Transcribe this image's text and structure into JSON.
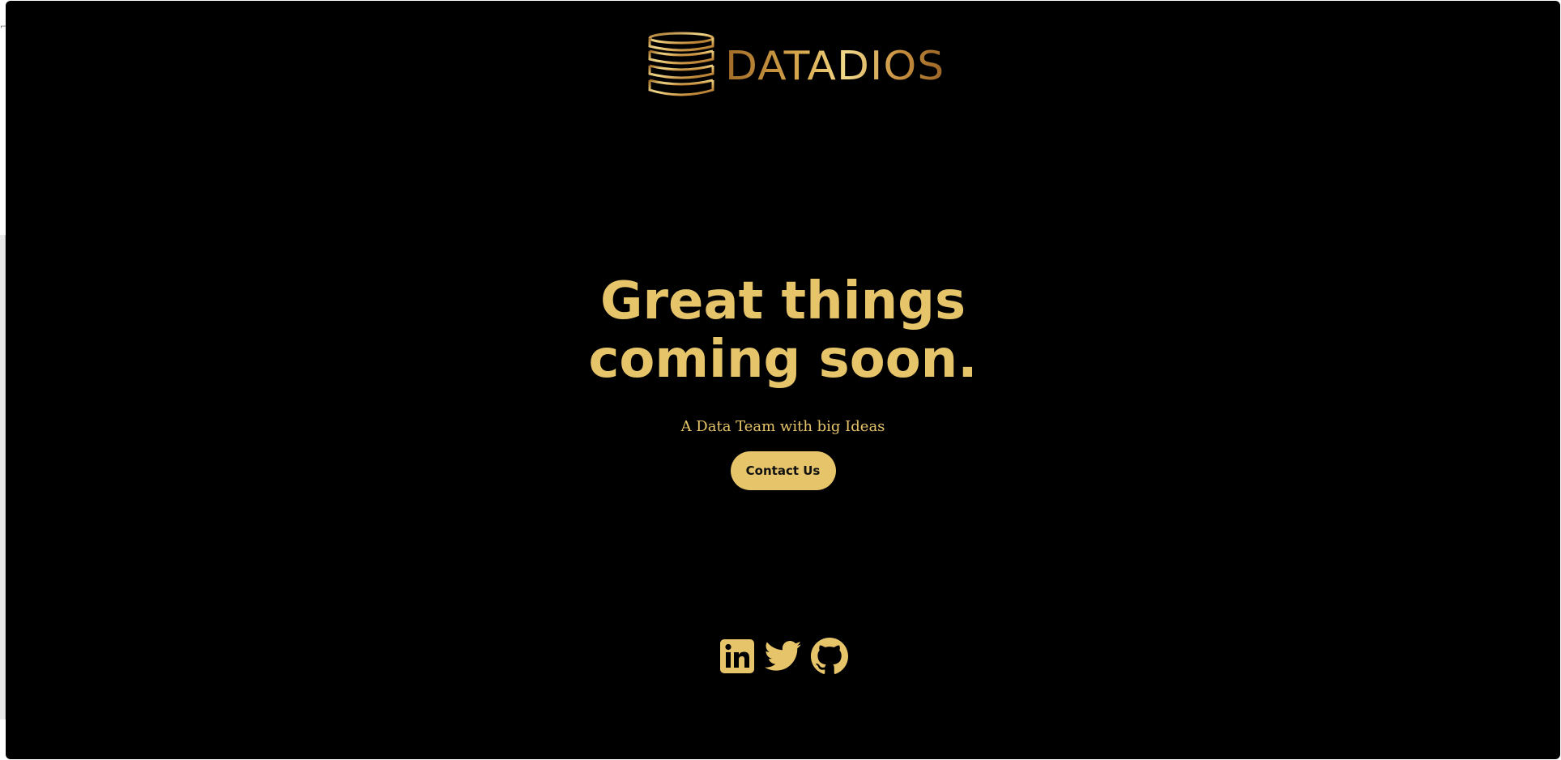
{
  "brand": {
    "name": "DATADIOS",
    "logo_icon": "database-stack-icon",
    "gradient": [
      "#a06a26",
      "#f2d98a",
      "#9a6426"
    ]
  },
  "hero": {
    "headline": "Great things coming soon.",
    "tagline": "A Data Team with big Ideas",
    "cta_label": "Contact Us"
  },
  "socials": [
    {
      "name": "linkedin",
      "icon": "linkedin-icon"
    },
    {
      "name": "twitter",
      "icon": "twitter-icon"
    },
    {
      "name": "github",
      "icon": "github-icon"
    }
  ],
  "colors": {
    "background": "#000000",
    "accent": "#e6c46a",
    "button_text": "#111111"
  }
}
